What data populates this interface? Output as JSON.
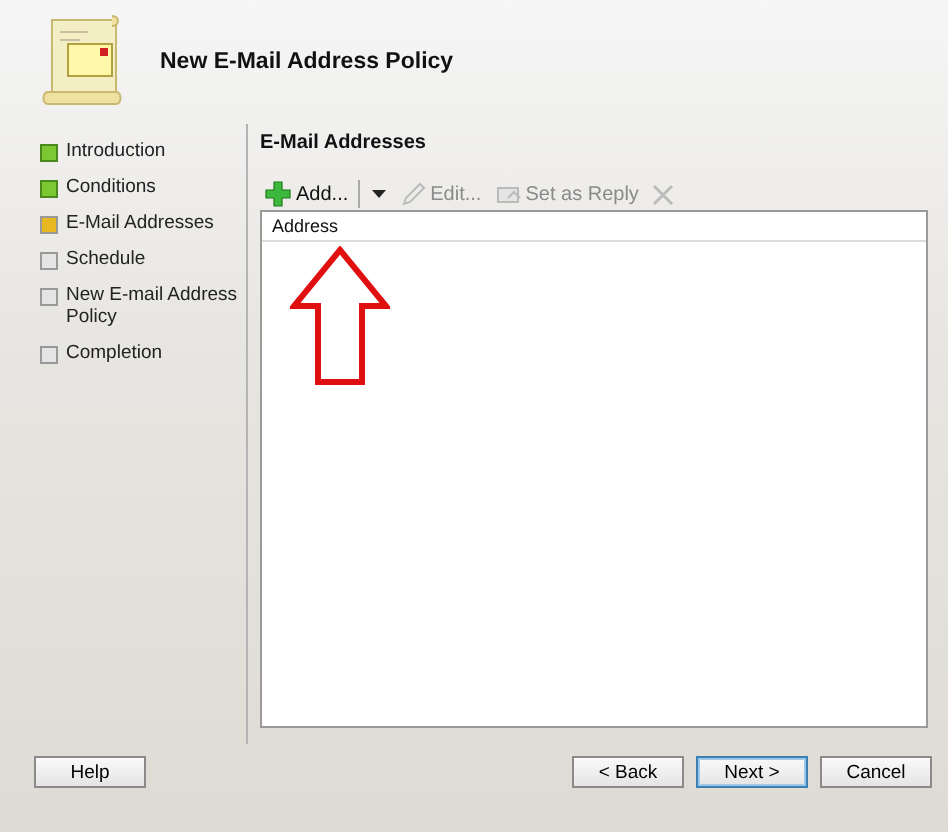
{
  "window": {
    "title": "New E-Mail Address Policy"
  },
  "steps": [
    {
      "label": "Introduction",
      "completed": true,
      "selected": false
    },
    {
      "label": "Conditions",
      "completed": true,
      "selected": false
    },
    {
      "label": "E-Mail Addresses",
      "completed": false,
      "selected": true
    },
    {
      "label": "Schedule",
      "completed": false,
      "selected": false
    },
    {
      "label": "New E-mail Address Policy",
      "completed": false,
      "selected": false
    },
    {
      "label": "Completion",
      "completed": false,
      "selected": false
    }
  ],
  "section_title": "E-Mail Addresses",
  "toolbar": [
    {
      "kind": "add",
      "label": "Add...",
      "disabled": false
    },
    {
      "kind": "dropdown",
      "disabled": false
    },
    {
      "kind": "edit",
      "label": "Edit...",
      "disabled": true
    },
    {
      "kind": "reply",
      "label": "Set as Reply",
      "disabled": true
    },
    {
      "kind": "delete",
      "disabled": true
    }
  ],
  "table": {
    "columns": [
      "Address"
    ]
  },
  "buttons": [
    {
      "label": "Help",
      "kind": "help"
    },
    {
      "label": "< Back",
      "kind": "back"
    },
    {
      "label": "Next >",
      "kind": "next",
      "default": true
    },
    {
      "label": "Cancel",
      "kind": "cancel"
    }
  ]
}
